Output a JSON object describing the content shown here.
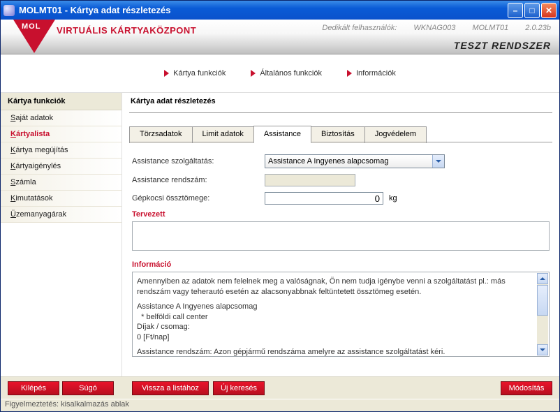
{
  "window": {
    "title": "MOLMT01 - Kártya adat részletezés"
  },
  "banner": {
    "brand": "VIRTUÁLIS KÁRTYAKÖZPONT",
    "meta_label": "Dedikált felhasználók:",
    "meta_user": "WKNAG003",
    "meta_app": "MOLMT01",
    "meta_ver": "2.0.23b",
    "tag": "TESZT RENDSZER"
  },
  "topmenu": [
    "Kártya funkciók",
    "Általános funkciók",
    "Információk"
  ],
  "sidebar": {
    "heading": "Kártya funkciók",
    "items": [
      {
        "prefix": "S",
        "rest": "aját adatok",
        "selected": false
      },
      {
        "prefix": "K",
        "rest": "ártyalista",
        "selected": true
      },
      {
        "prefix": "K",
        "rest": "ártya megújítás",
        "selected": false
      },
      {
        "prefix": "K",
        "rest": "ártyaigénylés",
        "selected": false
      },
      {
        "prefix": "S",
        "rest": "zámla",
        "selected": false
      },
      {
        "prefix": "K",
        "rest": "imutatások",
        "selected": false
      },
      {
        "prefix": "Ü",
        "rest": "zemanyagárak",
        "selected": false
      }
    ]
  },
  "main": {
    "heading": "Kártya adat részletezés",
    "tabs": [
      {
        "label": "Törzsadatok",
        "active": false
      },
      {
        "label": "Limit adatok",
        "active": false
      },
      {
        "label": "Assistance",
        "active": true
      },
      {
        "label": "Biztosítás",
        "active": false
      },
      {
        "label": "Jogvédelem",
        "active": false
      }
    ],
    "form": {
      "service_label": "Assistance szolgáltatás:",
      "service_value": "Assistance A Ingyenes alapcsomag",
      "plate_label": "Assistance rendszám:",
      "plate_value": "",
      "weight_label": "Gépkocsi össztömege:",
      "weight_value": "0",
      "weight_unit": "kg"
    },
    "section_planned": "Tervezett",
    "planned_text": "",
    "section_info": "Információ",
    "info_text_1": "Amennyiben az adatok nem felelnek meg a valóságnak, Ön nem tudja igénybe venni a szolgáltatást pl.: más rendszám vagy teherautó esetén az alacsonyabbnak feltüntetett össztömeg esetén.",
    "info_text_2": "Assistance A Ingyenes alapcsomag",
    "info_text_3": "  * belföldi call center",
    "info_text_4": "Díjak / csomag:",
    "info_text_5": "0 [Ft/nap]",
    "info_text_6": "Assistance rendszám: Azon gépjármű rendszáma amelyre az assistance szolgáltatást kéri."
  },
  "buttons": {
    "exit": "Kilépés",
    "help": "Súgó",
    "back": "Vissza a listához",
    "newsearch": "Új keresés",
    "modify": "Módosítás"
  },
  "statusbar": "Figyelmeztetés: kisalkalmazás ablak"
}
